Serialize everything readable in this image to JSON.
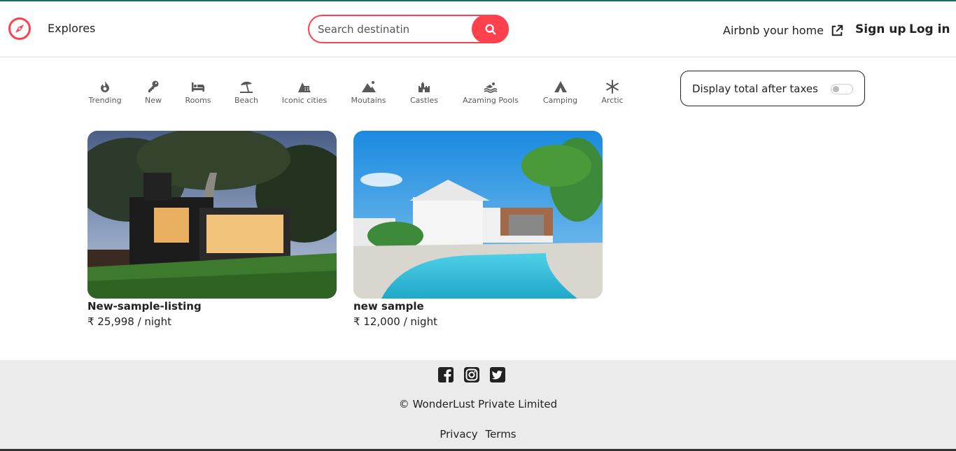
{
  "navbar": {
    "brand_icon": "compass-icon",
    "explore_label": "Explores",
    "search_placeholder": "Search destinatin",
    "search_icon": "search-icon",
    "host_label": "Airbnb your home",
    "host_icon": "external-link-icon",
    "signup_label": "Sign up",
    "login_label": "Log in",
    "accent_color": "#fe424d"
  },
  "filters": [
    {
      "label": "Trending",
      "icon": "fire-icon"
    },
    {
      "label": "New",
      "icon": "key-icon"
    },
    {
      "label": "Rooms",
      "icon": "bed-icon"
    },
    {
      "label": "Beach",
      "icon": "umbrella-beach-icon"
    },
    {
      "label": "Iconic cities",
      "icon": "city-icon"
    },
    {
      "label": "Moutains",
      "icon": "mountain-icon"
    },
    {
      "label": "Castles",
      "icon": "castle-icon"
    },
    {
      "label": "Azaming Pools",
      "icon": "swimmer-icon"
    },
    {
      "label": "Camping",
      "icon": "tent-icon"
    },
    {
      "label": "Arctic",
      "icon": "snowflake-icon"
    }
  ],
  "tax_toggle": {
    "label": "Display total after taxes",
    "checked": false
  },
  "listings": [
    {
      "title": "New-sample-listing",
      "price": "₹ 25,998 / night"
    },
    {
      "title": "new sample",
      "price": "₹ 12,000 / night"
    }
  ],
  "footer": {
    "socials": [
      "facebook-icon",
      "instagram-icon",
      "twitter-icon"
    ],
    "copyright": "© WonderLust Private Limited",
    "privacy_label": "Privacy",
    "terms_label": "Terms"
  }
}
